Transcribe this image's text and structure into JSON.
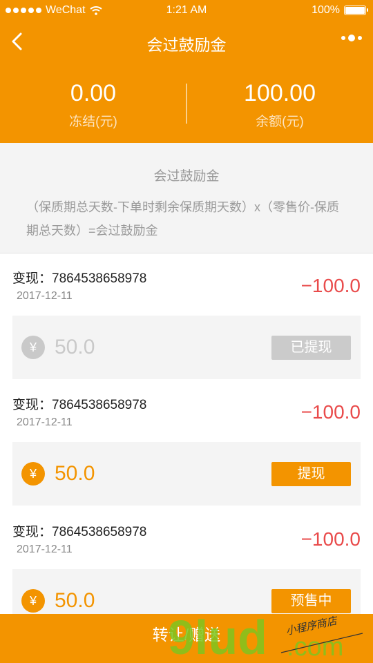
{
  "status_bar": {
    "carrier": "WeChat",
    "time": "1:21 AM",
    "battery": "100%"
  },
  "nav": {
    "title": "会过鼓励金"
  },
  "balances": [
    {
      "value": "0.00",
      "label": "冻结(元)"
    },
    {
      "value": "100.00",
      "label": "余额(元)"
    }
  ],
  "info": {
    "title": "会过鼓励金",
    "formula": "（保质期总天数-下单时剩余保质期天数）x（零售价-保质期总天数）=会过鼓励金"
  },
  "records": [
    {
      "label": "变现：7864538658978",
      "date": "2017-12-11",
      "amount": "−100.0",
      "sub_amount": "50.0",
      "currency": "¥",
      "button": "已提现",
      "state": "disabled"
    },
    {
      "label": "变现：7864538658978",
      "date": "2017-12-11",
      "amount": "−100.0",
      "sub_amount": "50.0",
      "currency": "¥",
      "button": "提现",
      "state": "active"
    },
    {
      "label": "变现：7864538658978",
      "date": "2017-12-11",
      "amount": "−100.0",
      "sub_amount": "50.0",
      "currency": "¥",
      "button": "预售中",
      "state": "active"
    }
  ],
  "bottom_button": "转让/赠送",
  "watermark": {
    "text": "9lud.com",
    "tagline": "小程序商店"
  },
  "colors": {
    "primary": "#f39400",
    "negative": "#e94b4b",
    "panel": "#f4f4f4",
    "disabled": "#cbcbcb"
  }
}
